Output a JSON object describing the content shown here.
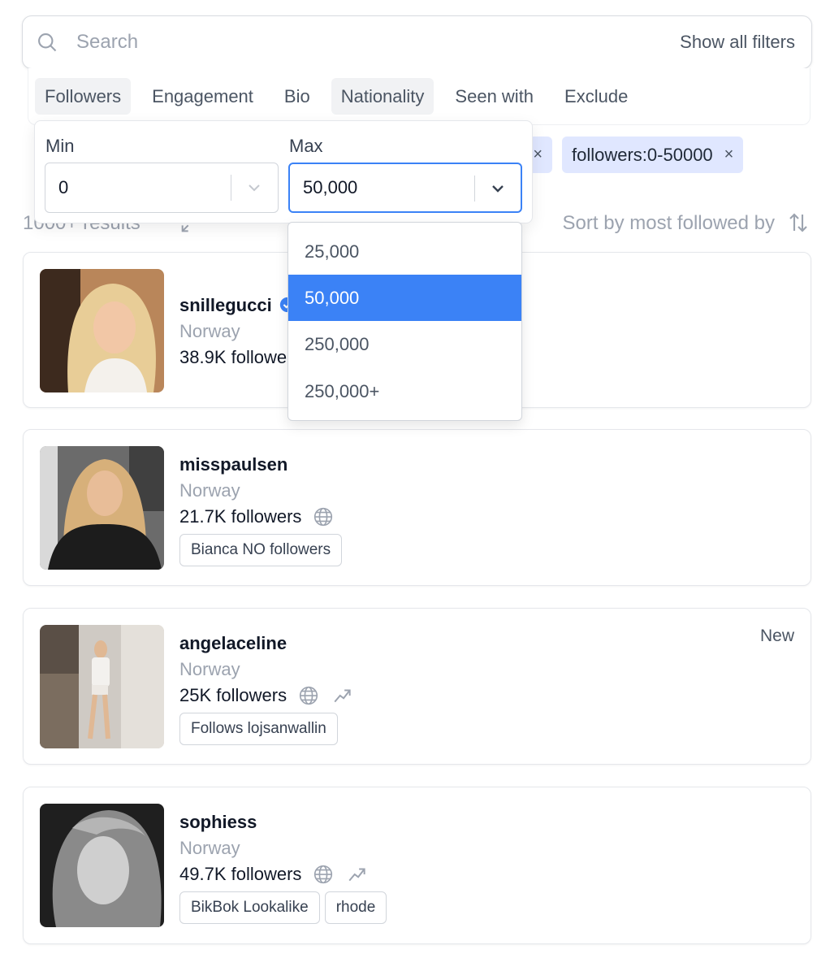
{
  "search": {
    "placeholder": "Search",
    "show_filters_label": "Show all filters"
  },
  "filter_tabs": [
    {
      "label": "Followers",
      "active": true
    },
    {
      "label": "Engagement",
      "active": false
    },
    {
      "label": "Bio",
      "active": false
    },
    {
      "label": "Nationality",
      "active": true
    },
    {
      "label": "Seen with",
      "active": false
    },
    {
      "label": "Exclude",
      "active": false
    }
  ],
  "chips": [
    {
      "label": "followers:0-50000",
      "close": "×"
    },
    {
      "label": "",
      "close": "×"
    }
  ],
  "range": {
    "min_label": "Min",
    "min_value": "0",
    "max_label": "Max",
    "max_value": "50,000",
    "options": [
      "25,000",
      "50,000",
      "250,000",
      "250,000+"
    ],
    "selected_option": "50,000"
  },
  "results": {
    "count_text": "1000+ results",
    "sort_label": "Sort by most followed by"
  },
  "cards": [
    {
      "username": "snillegucci",
      "country": "Norway",
      "followers": "38.9K followers",
      "verified": true,
      "tags": [],
      "new_label": ""
    },
    {
      "username": "misspaulsen",
      "country": "Norway",
      "followers": "21.7K followers",
      "tags": [
        "Bianca NO followers"
      ],
      "new_label": ""
    },
    {
      "username": "angelaceline",
      "country": "Norway",
      "followers": "25K followers",
      "tags": [
        "Follows lojsanwallin"
      ],
      "new_label": "New"
    },
    {
      "username": "sophiess",
      "country": "Norway",
      "followers": "49.7K followers",
      "tags": [
        "BikBok Lookalike",
        "rhode"
      ],
      "new_label": ""
    }
  ],
  "colors": {
    "accent": "#3b82f6",
    "chip_bg": "#e0e7ff",
    "muted_text": "#9ca3af"
  },
  "icons": [
    "search-icon",
    "close-icon",
    "chevron-down-icon",
    "expand-icon",
    "sort-icon",
    "globe-icon",
    "trend-up-icon",
    "verified-badge-icon"
  ]
}
